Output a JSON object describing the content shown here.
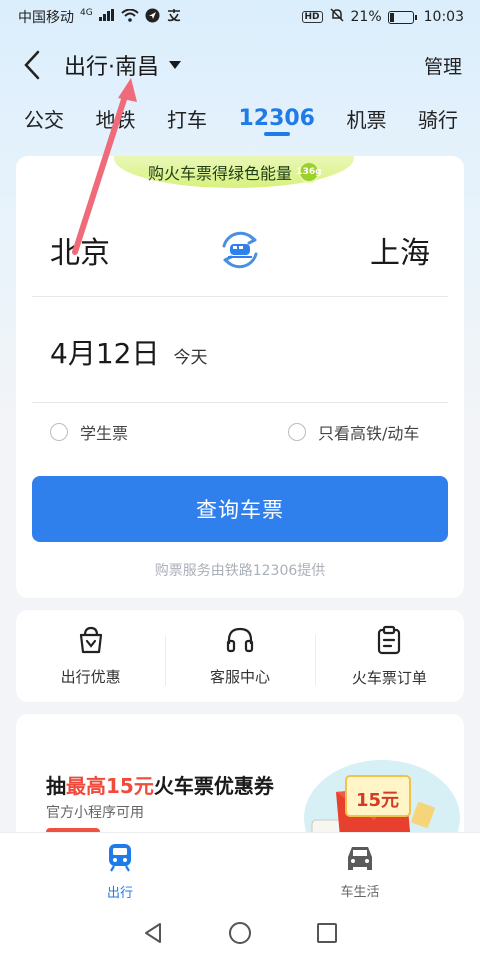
{
  "status_bar": {
    "carrier": "中国移动",
    "network": "4G",
    "battery_percent": "21%",
    "battery_level": 0.21,
    "time": "10:03",
    "hd_label": "HD"
  },
  "header": {
    "title": "出行·南昌",
    "manage_label": "管理"
  },
  "tabs": [
    {
      "label": "公交",
      "active": false
    },
    {
      "label": "地铁",
      "active": false
    },
    {
      "label": "打车",
      "active": false
    },
    {
      "label": "12306",
      "active": true
    },
    {
      "label": "机票",
      "active": false
    },
    {
      "label": "骑行",
      "active": false
    }
  ],
  "search_card": {
    "energy_banner": "购火车票得绿色能量",
    "energy_badge": "136g",
    "from_station": "北京",
    "to_station": "上海",
    "date": "4月12日",
    "date_sub": "今天",
    "option_student": "学生票",
    "option_highspeed": "只看高铁/动车",
    "query_button": "查询车票",
    "provider_text": "购票服务由铁路12306提供"
  },
  "shortcuts": [
    {
      "label": "出行优惠",
      "icon": "gift-bag-icon"
    },
    {
      "label": "客服中心",
      "icon": "headset-icon"
    },
    {
      "label": "火车票订单",
      "icon": "clipboard-icon"
    }
  ],
  "promo": {
    "title_prefix": "抽",
    "title_highlight": "最高15元",
    "title_suffix": "火车票优惠券",
    "subtitle": "官方小程序可用",
    "coupon_amount": "15元"
  },
  "bottom_nav": [
    {
      "label": "出行",
      "icon": "train-icon",
      "active": true
    },
    {
      "label": "车生活",
      "icon": "car-icon",
      "active": false
    }
  ],
  "colors": {
    "accent": "#1f7be8",
    "button": "#2f80ed",
    "promo_red": "#f04a3b",
    "annotation_arrow": "#ef6b7a"
  }
}
